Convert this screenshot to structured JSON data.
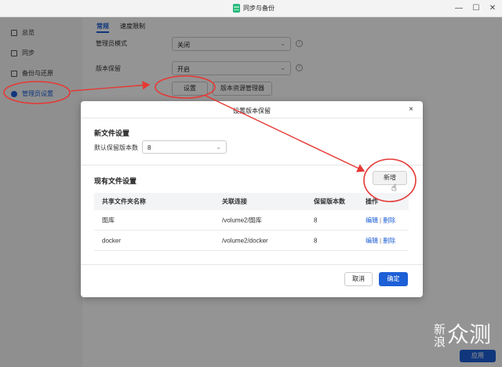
{
  "window": {
    "title": "同步与备份",
    "minimize": "—",
    "maximize": "☐",
    "close": "✕"
  },
  "sidebar": {
    "items": [
      {
        "label": "总览",
        "icon": "overview-icon"
      },
      {
        "label": "同步",
        "icon": "sync-icon"
      },
      {
        "label": "备份与还原",
        "icon": "backup-icon"
      },
      {
        "label": "管理员设置",
        "icon": "gear-icon",
        "active": true
      }
    ]
  },
  "main": {
    "tabs": [
      {
        "label": "常规",
        "active": true
      },
      {
        "label": "速度限制"
      }
    ],
    "admin_mode": {
      "label": "管理员模式",
      "value": "关闭"
    },
    "versioning": {
      "label": "版本保留",
      "value": "开启"
    },
    "settings_button": "设置",
    "version_manager_button": "版本资源管理器",
    "apply_button": "应用"
  },
  "modal": {
    "title": "设置版本保留",
    "close": "×",
    "new_file_section": "新文件设置",
    "default_versions_label": "默认保留版本数",
    "default_versions_value": "8",
    "existing_section": "现有文件设置",
    "add_button": "新增",
    "table": {
      "headers": [
        "共享文件夹名称",
        "关联连接",
        "保留版本数",
        "操作"
      ],
      "rows": [
        {
          "name": "图库",
          "link": "/volume2/图库",
          "versions": "8",
          "edit": "编辑",
          "delete": "删除"
        },
        {
          "name": "docker",
          "link": "/volume2/docker",
          "versions": "8",
          "edit": "编辑",
          "delete": "删除"
        }
      ]
    },
    "cancel_button": "取消",
    "ok_button": "确定"
  },
  "annotation_color": "#e53935",
  "accent_color": "#1d5fd6",
  "watermark": {
    "line1": "新",
    "line2": "浪",
    "text": "众测"
  }
}
